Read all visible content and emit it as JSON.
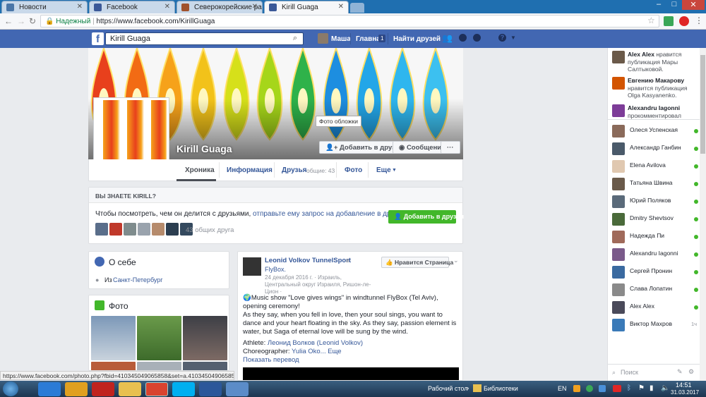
{
  "browser": {
    "tabs": [
      {
        "title": "Новости",
        "icon_color": "#4a76a8"
      },
      {
        "title": "Facebook",
        "icon_color": "#3b5998"
      },
      {
        "title": "Северокорейские рабы",
        "icon_color": "#a0522d"
      },
      {
        "title": "Kirill Guaga",
        "icon_color": "#3b5998"
      }
    ],
    "secure_label": "Надежный",
    "url": "https://www.facebook.com/KirillGuaga"
  },
  "fb_nav": {
    "search_value": "Kirill  Guaga",
    "user": "Маша",
    "home": "Главная",
    "home_count": "1",
    "find_friends": "Найти друзей"
  },
  "profile": {
    "name": "Kirill Guaga",
    "cover_tooltip": "Фото обложки",
    "add_friend": "Добавить в друзья",
    "message": "Сообщение",
    "more": "···",
    "tabs": {
      "timeline": "Хроника",
      "info": "Информация",
      "friends": "Друзья",
      "friends_common": "общие: 43",
      "photos": "Фото",
      "more": "Еще"
    }
  },
  "know_card": {
    "heading": "ВЫ ЗНАЕТЕ KIRILL?",
    "text_start": "Чтобы посмотреть, чем он делится с друзьями,",
    "text_link": "отправьте ему запрос на добавление в друзья.",
    "add_button": "Добавить в друзья",
    "mutual": "43 общих друга"
  },
  "about": {
    "title": "О себе",
    "from_label": "Из",
    "city": "Санкт-Петербург"
  },
  "photos": {
    "title": "Фото"
  },
  "post": {
    "author": "Leonid Volkov TunnelSport",
    "in": "в",
    "place": "FlyBox.",
    "like_page": "Нравится Страница",
    "meta": "24 декабря 2016 г. · Израиль, Центральный округ Израиля, Ришон-ле-Цион ·",
    "line1": "🌍Music show \"Love gives wings\" in windtunnel FlyBox (Tel Aviv), opening ceremony!",
    "line2": "As they say, when you fell in love, then your soul sings, you want to dance and your heart floating in the sky. As they say, passion element is water, but Saga of eternal love will be sung by the wind.",
    "athlete_label": "Athlete:",
    "athlete": "Леонид Волков (Leonid Volkov)",
    "choreo_label": "Choreographer:",
    "choreo": "Yulia Oko...",
    "more": "Еще",
    "translate": "Показать перевод"
  },
  "sidebar": {
    "feed": [
      {
        "name": "Alex Alex",
        "text": "нравится публикация Мары Салтыковой."
      },
      {
        "name": "Евгению Макарову",
        "text": "нравится публикация Olga Kasyanenko."
      },
      {
        "name": "Alexandru Iagonni",
        "text": "прокомментировал"
      }
    ],
    "contacts": [
      {
        "name": "Олеся Успенская",
        "online": true
      },
      {
        "name": "Александр Ганбин",
        "online": true
      },
      {
        "name": "Elena Avilova",
        "online": true
      },
      {
        "name": "Татьяна Швина",
        "online": true
      },
      {
        "name": "Юрий Поляков",
        "online": true
      },
      {
        "name": "Dmitry Shevtsov",
        "online": true
      },
      {
        "name": "Надежда Пи",
        "online": true
      },
      {
        "name": "Alexandru Iagonni",
        "online": true
      },
      {
        "name": "Сергей Пронин",
        "online": true
      },
      {
        "name": "Слава Лопатин",
        "online": true
      },
      {
        "name": "Alex Alex",
        "online": true
      },
      {
        "name": "Виктор Махров",
        "online": false,
        "status": "1ч"
      }
    ],
    "search_placeholder": "Поиск"
  },
  "status_url": "https://www.facebook.com/photo.php?fbid=410345049065858&set=a.410345049065853.107374...",
  "taskbar": {
    "desktop": "Рабочий стол",
    "libraries": "Библиотеки",
    "lang": "EN",
    "time": "14:51",
    "date": "31.03.2017"
  }
}
